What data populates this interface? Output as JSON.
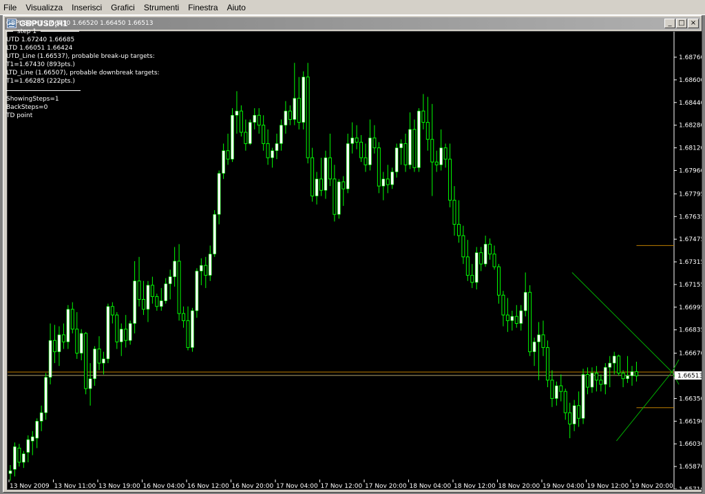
{
  "menu": [
    "File",
    "Visualizza",
    "Inserisci",
    "Grafici",
    "Strumenti",
    "Finestra",
    "Aiuto"
  ],
  "window": {
    "title": "GBPUSD,H1",
    "buttons": {
      "minimize": "_",
      "maximize": "□",
      "close": "×"
    }
  },
  "info": {
    "ohlc": "GBPUSD,H1  1.66510 1.66520 1.66450 1.66513",
    "step": "step 1",
    "utd": "UTD 1.67240  1.66685",
    "ltd": "LTD  1.66051  1.66424",
    "utd_line": "UTD_Line (1.66537), probable break-up targets:",
    "t1_up": "T1=1.67430 (893pts.)",
    "ltd_line": "LTD_Line (1.66507), probable downbreak targets:",
    "t1_down": "T1=1.66285 (222pts.)",
    "showing_steps": "ShowingSteps=1",
    "back_steps": "BackSteps=0",
    "td_point": "TD point"
  },
  "price_axis": {
    "labels": [
      "1.68760",
      "1.68600",
      "1.68440",
      "1.68280",
      "1.68120",
      "1.67960",
      "1.67795",
      "1.67635",
      "1.67475",
      "1.67315",
      "1.67155",
      "1.66995",
      "1.66835",
      "1.66670",
      "1.66510",
      "1.66350",
      "1.66190",
      "1.66030",
      "1.65870",
      "1.65710"
    ],
    "current_price": "1.66513"
  },
  "time_axis": {
    "labels": [
      "13 Nov 2009",
      "13 Nov 11:00",
      "13 Nov 19:00",
      "16 Nov 04:00",
      "16 Nov 12:00",
      "16 Nov 20:00",
      "17 Nov 04:00",
      "17 Nov 12:00",
      "17 Nov 20:00",
      "18 Nov 04:00",
      "18 Nov 12:00",
      "18 Nov 20:00",
      "19 Nov 04:00",
      "19 Nov 12:00",
      "19 Nov 20:00"
    ]
  },
  "chart_data": {
    "type": "candlestick",
    "symbol": "GBPUSD",
    "timeframe": "H1",
    "ylim": [
      1.6571,
      1.6894
    ],
    "colors": {
      "bull": "#ffffff",
      "bear": "#000000",
      "wick": "#00ff00",
      "background": "#000000",
      "trend_line": "#00b000",
      "level": "#c08000",
      "bid_line": "#b4a46e"
    },
    "td_lines": {
      "utd": {
        "from": [
          1.6724,
          126.5
        ],
        "to": [
          1.66537,
          149
        ]
      },
      "ltd": {
        "from": [
          1.66051,
          136.5
        ],
        "to": [
          1.66537,
          149
        ]
      }
    },
    "levels": {
      "upper_target": 1.6743,
      "lower_target": 1.66285,
      "bid": 1.66513,
      "ask_line": 1.66537
    },
    "candles": [
      [
        1.6582,
        1.6588,
        1.6577,
        1.6584
      ],
      [
        1.6585,
        1.6604,
        1.658,
        1.6601
      ],
      [
        1.66,
        1.6603,
        1.6587,
        1.659
      ],
      [
        1.659,
        1.6598,
        1.6586,
        1.6596
      ],
      [
        1.6597,
        1.6609,
        1.659,
        1.6606
      ],
      [
        1.6605,
        1.6612,
        1.6595,
        1.6608
      ],
      [
        1.6607,
        1.6621,
        1.66,
        1.6619
      ],
      [
        1.6619,
        1.663,
        1.6612,
        1.6625
      ],
      [
        1.6625,
        1.6653,
        1.662,
        1.665
      ],
      [
        1.665,
        1.6688,
        1.6645,
        1.6676
      ],
      [
        1.6676,
        1.6687,
        1.666,
        1.6668
      ],
      [
        1.6668,
        1.6686,
        1.6658,
        1.668
      ],
      [
        1.668,
        1.6688,
        1.667,
        1.6675
      ],
      [
        1.6675,
        1.6701,
        1.667,
        1.6698
      ],
      [
        1.6698,
        1.6703,
        1.6681,
        1.6684
      ],
      [
        1.6684,
        1.6696,
        1.6663,
        1.6667
      ],
      [
        1.6667,
        1.6684,
        1.6662,
        1.6681
      ],
      [
        1.6681,
        1.6682,
        1.6638,
        1.6642
      ],
      [
        1.6642,
        1.666,
        1.663,
        1.6649
      ],
      [
        1.6649,
        1.6672,
        1.6644,
        1.667
      ],
      [
        1.667,
        1.6679,
        1.6655,
        1.666
      ],
      [
        1.666,
        1.6668,
        1.6652,
        1.6663
      ],
      [
        1.6663,
        1.6702,
        1.666,
        1.67
      ],
      [
        1.67,
        1.6703,
        1.6688,
        1.6694
      ],
      [
        1.6694,
        1.6696,
        1.667,
        1.6675
      ],
      [
        1.6675,
        1.6688,
        1.6665,
        1.6684
      ],
      [
        1.6684,
        1.6694,
        1.6671,
        1.6676
      ],
      [
        1.6676,
        1.669,
        1.6673,
        1.6688
      ],
      [
        1.6688,
        1.6732,
        1.6681,
        1.6718
      ],
      [
        1.6718,
        1.6735,
        1.67,
        1.6705
      ],
      [
        1.6705,
        1.6718,
        1.6694,
        1.6698
      ],
      [
        1.6698,
        1.6718,
        1.6689,
        1.6715
      ],
      [
        1.6715,
        1.6721,
        1.6702,
        1.6707
      ],
      [
        1.6707,
        1.6709,
        1.6697,
        1.67
      ],
      [
        1.67,
        1.6713,
        1.6697,
        1.6704
      ],
      [
        1.6704,
        1.672,
        1.6702,
        1.6716
      ],
      [
        1.6716,
        1.6726,
        1.6705,
        1.6721
      ],
      [
        1.6721,
        1.6742,
        1.6714,
        1.6732
      ],
      [
        1.6732,
        1.6744,
        1.669,
        1.6695
      ],
      [
        1.6695,
        1.67,
        1.6685,
        1.669
      ],
      [
        1.669,
        1.67,
        1.6669,
        1.6671
      ],
      [
        1.6671,
        1.6699,
        1.6668,
        1.6697
      ],
      [
        1.6697,
        1.6727,
        1.6692,
        1.6725
      ],
      [
        1.6725,
        1.6734,
        1.6715,
        1.6729
      ],
      [
        1.6729,
        1.6735,
        1.6713,
        1.6722
      ],
      [
        1.6722,
        1.6743,
        1.6718,
        1.6737
      ],
      [
        1.6737,
        1.6768,
        1.6735,
        1.6765
      ],
      [
        1.6765,
        1.6796,
        1.6758,
        1.6794
      ],
      [
        1.6794,
        1.6815,
        1.679,
        1.681
      ],
      [
        1.681,
        1.6822,
        1.68,
        1.6804
      ],
      [
        1.6804,
        1.684,
        1.6802,
        1.6835
      ],
      [
        1.6835,
        1.6852,
        1.6822,
        1.6838
      ],
      [
        1.6838,
        1.6842,
        1.682,
        1.6823
      ],
      [
        1.6823,
        1.6832,
        1.681,
        1.6815
      ],
      [
        1.6815,
        1.6832,
        1.6814,
        1.683
      ],
      [
        1.683,
        1.684,
        1.6825,
        1.6835
      ],
      [
        1.6835,
        1.684,
        1.6822,
        1.6828
      ],
      [
        1.6828,
        1.6835,
        1.681,
        1.6815
      ],
      [
        1.6815,
        1.6825,
        1.68,
        1.6805
      ],
      [
        1.6805,
        1.6812,
        1.6798,
        1.681
      ],
      [
        1.681,
        1.6822,
        1.6804,
        1.6815
      ],
      [
        1.6815,
        1.6832,
        1.681,
        1.6828
      ],
      [
        1.6828,
        1.6845,
        1.6822,
        1.6838
      ],
      [
        1.6838,
        1.6842,
        1.6828,
        1.6832
      ],
      [
        1.6832,
        1.6872,
        1.6828,
        1.6847
      ],
      [
        1.6847,
        1.6862,
        1.6825,
        1.683
      ],
      [
        1.683,
        1.6866,
        1.6825,
        1.6862
      ],
      [
        1.6862,
        1.6872,
        1.6801,
        1.6805
      ],
      [
        1.6805,
        1.6812,
        1.6774,
        1.6778
      ],
      [
        1.6778,
        1.6795,
        1.6772,
        1.679
      ],
      [
        1.679,
        1.6805,
        1.6778,
        1.6782
      ],
      [
        1.6782,
        1.681,
        1.6776,
        1.6805
      ],
      [
        1.6805,
        1.6822,
        1.6785,
        1.679
      ],
      [
        1.679,
        1.68,
        1.676,
        1.6765
      ],
      [
        1.6765,
        1.679,
        1.6762,
        1.6788
      ],
      [
        1.6788,
        1.6792,
        1.6771,
        1.6783
      ],
      [
        1.6783,
        1.6822,
        1.678,
        1.6815
      ],
      [
        1.6815,
        1.683,
        1.6808,
        1.6819
      ],
      [
        1.6819,
        1.6828,
        1.6811,
        1.6816
      ],
      [
        1.6816,
        1.6821,
        1.6802,
        1.6805
      ],
      [
        1.6805,
        1.6815,
        1.6795,
        1.68
      ],
      [
        1.68,
        1.6832,
        1.6796,
        1.6819
      ],
      [
        1.6819,
        1.6828,
        1.6808,
        1.6812
      ],
      [
        1.6812,
        1.6816,
        1.678,
        1.6785
      ],
      [
        1.6785,
        1.6795,
        1.6775,
        1.679
      ],
      [
        1.679,
        1.68,
        1.678,
        1.6786
      ],
      [
        1.6786,
        1.6798,
        1.6783,
        1.6795
      ],
      [
        1.6795,
        1.6815,
        1.6791,
        1.6812
      ],
      [
        1.6812,
        1.6818,
        1.68,
        1.6815
      ],
      [
        1.6815,
        1.6822,
        1.6795,
        1.68
      ],
      [
        1.68,
        1.6837,
        1.6797,
        1.6825
      ],
      [
        1.6825,
        1.6832,
        1.6795,
        1.6798
      ],
      [
        1.6798,
        1.684,
        1.6795,
        1.6838
      ],
      [
        1.6838,
        1.685,
        1.6825,
        1.683
      ],
      [
        1.683,
        1.6848,
        1.681,
        1.6818
      ],
      [
        1.6818,
        1.6843,
        1.6778,
        1.6802
      ],
      [
        1.6802,
        1.681,
        1.6795,
        1.68
      ],
      [
        1.68,
        1.6825,
        1.6796,
        1.6812
      ],
      [
        1.6812,
        1.6815,
        1.6798,
        1.6804
      ],
      [
        1.6804,
        1.6815,
        1.677,
        1.6775
      ],
      [
        1.6775,
        1.6785,
        1.675,
        1.6758
      ],
      [
        1.6758,
        1.6775,
        1.6745,
        1.675
      ],
      [
        1.675,
        1.6757,
        1.673,
        1.6735
      ],
      [
        1.6735,
        1.6747,
        1.6718,
        1.6722
      ],
      [
        1.6722,
        1.673,
        1.6713,
        1.6717
      ],
      [
        1.6717,
        1.6742,
        1.6712,
        1.6738
      ],
      [
        1.6738,
        1.6742,
        1.6725,
        1.673
      ],
      [
        1.673,
        1.675,
        1.6728,
        1.6744
      ],
      [
        1.6744,
        1.6748,
        1.6733,
        1.6737
      ],
      [
        1.6737,
        1.6743,
        1.6726,
        1.6728
      ],
      [
        1.6728,
        1.673,
        1.6702,
        1.6708
      ],
      [
        1.6708,
        1.6711,
        1.6686,
        1.6694
      ],
      [
        1.6694,
        1.6706,
        1.6682,
        1.669
      ],
      [
        1.669,
        1.6697,
        1.6683,
        1.6693
      ],
      [
        1.6693,
        1.6701,
        1.6685,
        1.6688
      ],
      [
        1.6688,
        1.6701,
        1.6683,
        1.6697
      ],
      [
        1.6697,
        1.6724,
        1.6693,
        1.671
      ],
      [
        1.671,
        1.6715,
        1.6665,
        1.6668
      ],
      [
        1.6668,
        1.6678,
        1.6658,
        1.6675
      ],
      [
        1.6675,
        1.6689,
        1.6648,
        1.668
      ],
      [
        1.668,
        1.669,
        1.6665,
        1.6671
      ],
      [
        1.6671,
        1.6676,
        1.6643,
        1.6648
      ],
      [
        1.6648,
        1.6655,
        1.6629,
        1.6635
      ],
      [
        1.6635,
        1.6647,
        1.663,
        1.6644
      ],
      [
        1.6644,
        1.6652,
        1.6633,
        1.664
      ],
      [
        1.664,
        1.6642,
        1.662,
        1.6625
      ],
      [
        1.6625,
        1.6632,
        1.6607,
        1.6617
      ],
      [
        1.6617,
        1.6634,
        1.6612,
        1.663
      ],
      [
        1.663,
        1.664,
        1.6615,
        1.6621
      ],
      [
        1.6621,
        1.6656,
        1.6617,
        1.6652
      ],
      [
        1.6652,
        1.6657,
        1.6638,
        1.6643
      ],
      [
        1.6643,
        1.6657,
        1.6639,
        1.6653
      ],
      [
        1.6653,
        1.6658,
        1.664,
        1.6648
      ],
      [
        1.6648,
        1.6652,
        1.664,
        1.6645
      ],
      [
        1.6645,
        1.666,
        1.6638,
        1.6657
      ],
      [
        1.6657,
        1.6665,
        1.6643,
        1.666
      ],
      [
        1.666,
        1.6668,
        1.6652,
        1.6665
      ],
      [
        1.6665,
        1.6666,
        1.6651,
        1.6653
      ],
      [
        1.6653,
        1.6655,
        1.6643,
        1.6649
      ],
      [
        1.6649,
        1.6665,
        1.6646,
        1.6651
      ],
      [
        1.6651,
        1.6658,
        1.6644,
        1.6654
      ],
      [
        1.6654,
        1.6661,
        1.6647,
        1.6651
      ]
    ]
  }
}
